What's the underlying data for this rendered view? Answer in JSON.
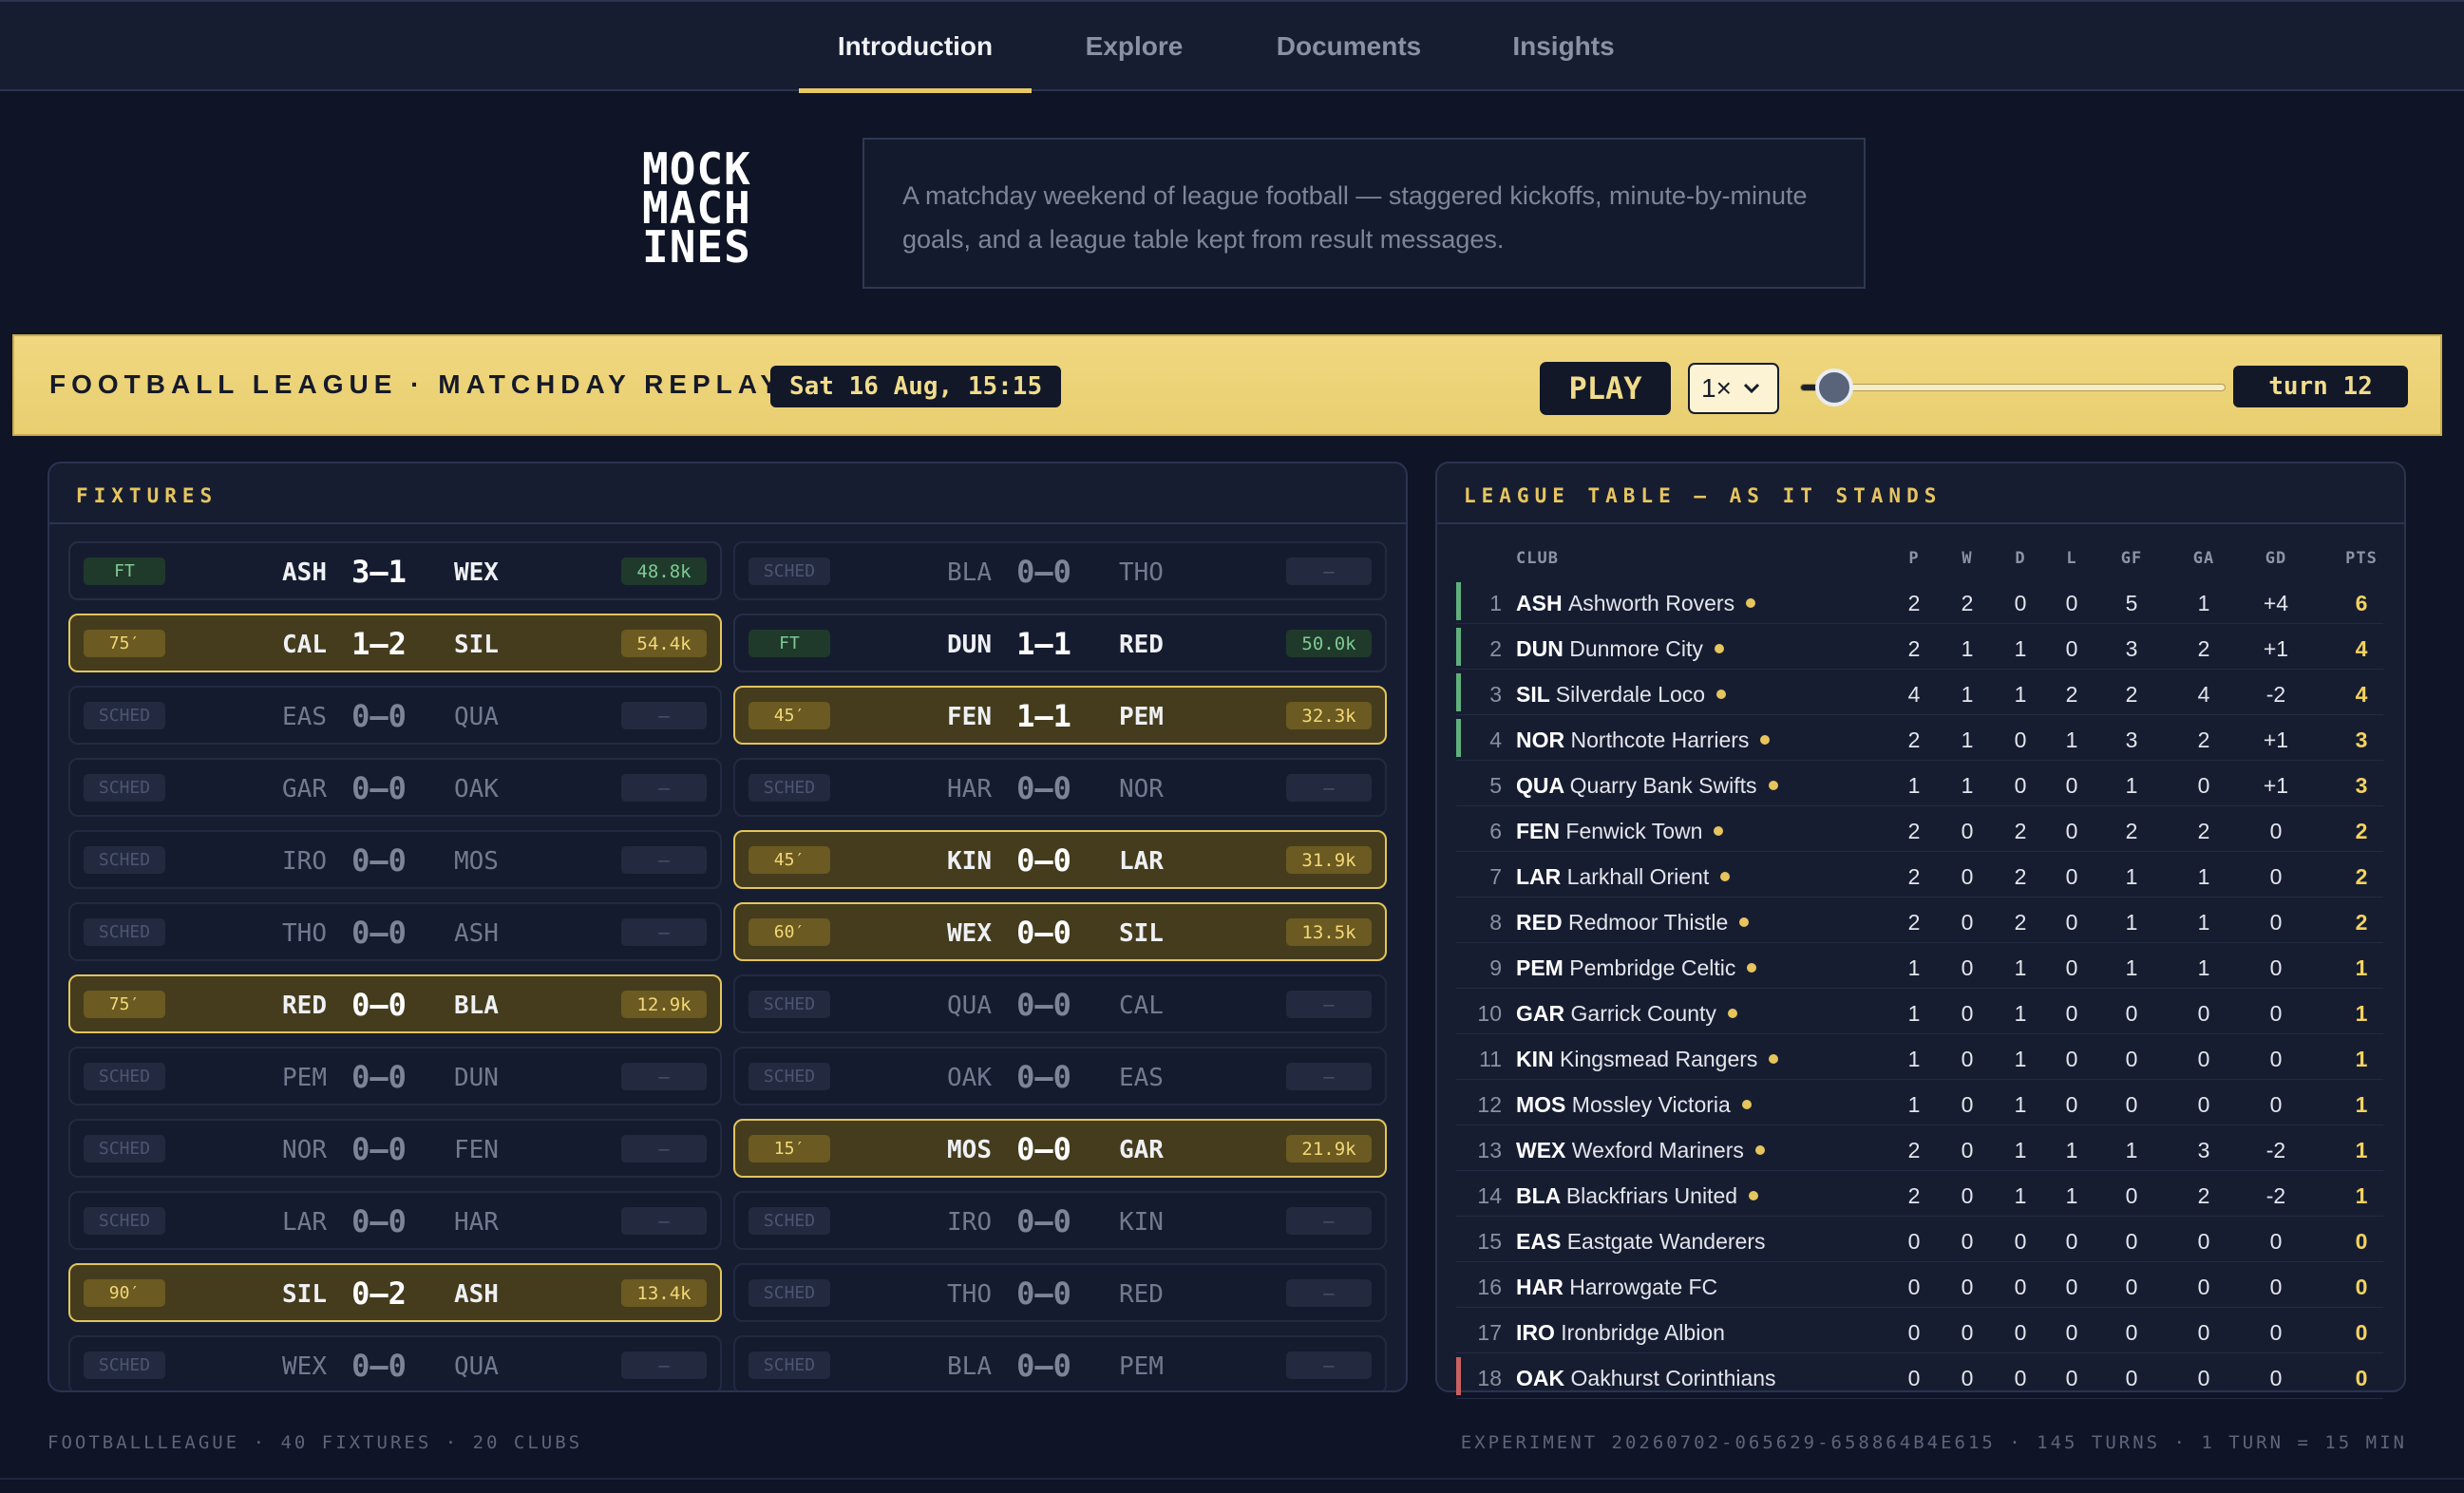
{
  "nav": {
    "tabs": [
      {
        "label": "Introduction",
        "active": true
      },
      {
        "label": "Explore",
        "active": false
      },
      {
        "label": "Documents",
        "active": false
      },
      {
        "label": "Insights",
        "active": false
      }
    ]
  },
  "logo": {
    "text": "MOCK MACH INES",
    "lines": [
      "MOCK",
      "MACH",
      "INES"
    ]
  },
  "intro": {
    "text": "A matchday weekend of league football — staggered kickoffs, minute-by-minute goals, and a league table kept from result messages."
  },
  "control_bar": {
    "title": "FOOTBALL LEAGUE · MATCHDAY REPLAY",
    "date": "Sat 16 Aug, 15:15",
    "play_label": "PLAY",
    "speed": "1×",
    "progress": 0.08,
    "turn_label": "turn 12"
  },
  "fixtures": {
    "title": "FIXTURES",
    "matches": [
      {
        "col": 0,
        "row": 0,
        "status": "ft",
        "badge": "FT",
        "home": "ASH",
        "score": "3–1",
        "away": "WEX",
        "att": "48.8k"
      },
      {
        "col": 1,
        "row": 0,
        "status": "sched",
        "badge": "SCHED",
        "home": "BLA",
        "score": "0–0",
        "away": "THO",
        "att": "–"
      },
      {
        "col": 0,
        "row": 1,
        "status": "live",
        "badge": "75′",
        "home": "CAL",
        "score": "1–2",
        "away": "SIL",
        "att": "54.4k"
      },
      {
        "col": 1,
        "row": 1,
        "status": "ft",
        "badge": "FT",
        "home": "DUN",
        "score": "1–1",
        "away": "RED",
        "att": "50.0k"
      },
      {
        "col": 0,
        "row": 2,
        "status": "sched",
        "badge": "SCHED",
        "home": "EAS",
        "score": "0–0",
        "away": "QUA",
        "att": "–"
      },
      {
        "col": 1,
        "row": 2,
        "status": "live",
        "badge": "45′",
        "home": "FEN",
        "score": "1–1",
        "away": "PEM",
        "att": "32.3k"
      },
      {
        "col": 0,
        "row": 3,
        "status": "sched",
        "badge": "SCHED",
        "home": "GAR",
        "score": "0–0",
        "away": "OAK",
        "att": "–"
      },
      {
        "col": 1,
        "row": 3,
        "status": "sched",
        "badge": "SCHED",
        "home": "HAR",
        "score": "0–0",
        "away": "NOR",
        "att": "–"
      },
      {
        "col": 0,
        "row": 4,
        "status": "sched",
        "badge": "SCHED",
        "home": "IRO",
        "score": "0–0",
        "away": "MOS",
        "att": "–"
      },
      {
        "col": 1,
        "row": 4,
        "status": "live",
        "badge": "45′",
        "home": "KIN",
        "score": "0–0",
        "away": "LAR",
        "att": "31.9k"
      },
      {
        "col": 0,
        "row": 5,
        "status": "sched",
        "badge": "SCHED",
        "home": "THO",
        "score": "0–0",
        "away": "ASH",
        "att": "–"
      },
      {
        "col": 1,
        "row": 5,
        "status": "live",
        "badge": "60′",
        "home": "WEX",
        "score": "0–0",
        "away": "SIL",
        "att": "13.5k"
      },
      {
        "col": 0,
        "row": 6,
        "status": "live",
        "badge": "75′",
        "home": "RED",
        "score": "0–0",
        "away": "BLA",
        "att": "12.9k"
      },
      {
        "col": 1,
        "row": 6,
        "status": "sched",
        "badge": "SCHED",
        "home": "QUA",
        "score": "0–0",
        "away": "CAL",
        "att": "–"
      },
      {
        "col": 0,
        "row": 7,
        "status": "sched",
        "badge": "SCHED",
        "home": "PEM",
        "score": "0–0",
        "away": "DUN",
        "att": "–"
      },
      {
        "col": 1,
        "row": 7,
        "status": "sched",
        "badge": "SCHED",
        "home": "OAK",
        "score": "0–0",
        "away": "EAS",
        "att": "–"
      },
      {
        "col": 0,
        "row": 8,
        "status": "sched",
        "badge": "SCHED",
        "home": "NOR",
        "score": "0–0",
        "away": "FEN",
        "att": "–"
      },
      {
        "col": 1,
        "row": 8,
        "status": "live",
        "badge": "15′",
        "home": "MOS",
        "score": "0–0",
        "away": "GAR",
        "att": "21.9k"
      },
      {
        "col": 0,
        "row": 9,
        "status": "sched",
        "badge": "SCHED",
        "home": "LAR",
        "score": "0–0",
        "away": "HAR",
        "att": "–"
      },
      {
        "col": 1,
        "row": 9,
        "status": "sched",
        "badge": "SCHED",
        "home": "IRO",
        "score": "0–0",
        "away": "KIN",
        "att": "–"
      },
      {
        "col": 0,
        "row": 10,
        "status": "live",
        "badge": "90′",
        "home": "SIL",
        "score": "0–2",
        "away": "ASH",
        "att": "13.4k"
      },
      {
        "col": 1,
        "row": 10,
        "status": "sched",
        "badge": "SCHED",
        "home": "THO",
        "score": "0–0",
        "away": "RED",
        "att": "–"
      },
      {
        "col": 0,
        "row": 11,
        "status": "sched",
        "badge": "SCHED",
        "home": "WEX",
        "score": "0–0",
        "away": "QUA",
        "att": "–"
      },
      {
        "col": 1,
        "row": 11,
        "status": "sched",
        "badge": "SCHED",
        "home": "BLA",
        "score": "0–0",
        "away": "PEM",
        "att": "–"
      }
    ]
  },
  "league_table": {
    "title": "LEAGUE TABLE — AS IT STANDS",
    "columns": [
      "CLUB",
      "P",
      "W",
      "D",
      "L",
      "GF",
      "GA",
      "GD",
      "PTS"
    ],
    "colors": {
      "promotion": "#5fb07c",
      "relegation": "#c96060",
      "form_dot": "#e6c55d"
    },
    "rows": [
      {
        "pos": "1",
        "abbr": "ASH",
        "name": "Ashworth Rovers",
        "form": true,
        "zone": "promotion",
        "p": "2",
        "w": "2",
        "d": "0",
        "l": "0",
        "gf": "5",
        "ga": "1",
        "gd": "+4",
        "pts": "6"
      },
      {
        "pos": "2",
        "abbr": "DUN",
        "name": "Dunmore City",
        "form": true,
        "zone": "promotion",
        "p": "2",
        "w": "1",
        "d": "1",
        "l": "0",
        "gf": "3",
        "ga": "2",
        "gd": "+1",
        "pts": "4"
      },
      {
        "pos": "3",
        "abbr": "SIL",
        "name": "Silverdale Loco",
        "form": true,
        "zone": "promotion",
        "p": "4",
        "w": "1",
        "d": "1",
        "l": "2",
        "gf": "2",
        "ga": "4",
        "gd": "-2",
        "pts": "4"
      },
      {
        "pos": "4",
        "abbr": "NOR",
        "name": "Northcote Harriers",
        "form": true,
        "zone": "promotion",
        "p": "2",
        "w": "1",
        "d": "0",
        "l": "1",
        "gf": "3",
        "ga": "2",
        "gd": "+1",
        "pts": "3"
      },
      {
        "pos": "5",
        "abbr": "QUA",
        "name": "Quarry Bank Swifts",
        "form": true,
        "zone": "",
        "p": "1",
        "w": "1",
        "d": "0",
        "l": "0",
        "gf": "1",
        "ga": "0",
        "gd": "+1",
        "pts": "3"
      },
      {
        "pos": "6",
        "abbr": "FEN",
        "name": "Fenwick Town",
        "form": true,
        "zone": "",
        "p": "2",
        "w": "0",
        "d": "2",
        "l": "0",
        "gf": "2",
        "ga": "2",
        "gd": "0",
        "pts": "2"
      },
      {
        "pos": "7",
        "abbr": "LAR",
        "name": "Larkhall Orient",
        "form": true,
        "zone": "",
        "p": "2",
        "w": "0",
        "d": "2",
        "l": "0",
        "gf": "1",
        "ga": "1",
        "gd": "0",
        "pts": "2"
      },
      {
        "pos": "8",
        "abbr": "RED",
        "name": "Redmoor Thistle",
        "form": true,
        "zone": "",
        "p": "2",
        "w": "0",
        "d": "2",
        "l": "0",
        "gf": "1",
        "ga": "1",
        "gd": "0",
        "pts": "2"
      },
      {
        "pos": "9",
        "abbr": "PEM",
        "name": "Pembridge Celtic",
        "form": true,
        "zone": "",
        "p": "1",
        "w": "0",
        "d": "1",
        "l": "0",
        "gf": "1",
        "ga": "1",
        "gd": "0",
        "pts": "1"
      },
      {
        "pos": "10",
        "abbr": "GAR",
        "name": "Garrick County",
        "form": true,
        "zone": "",
        "p": "1",
        "w": "0",
        "d": "1",
        "l": "0",
        "gf": "0",
        "ga": "0",
        "gd": "0",
        "pts": "1"
      },
      {
        "pos": "11",
        "abbr": "KIN",
        "name": "Kingsmead Rangers",
        "form": true,
        "zone": "",
        "p": "1",
        "w": "0",
        "d": "1",
        "l": "0",
        "gf": "0",
        "ga": "0",
        "gd": "0",
        "pts": "1"
      },
      {
        "pos": "12",
        "abbr": "MOS",
        "name": "Mossley Victoria",
        "form": true,
        "zone": "",
        "p": "1",
        "w": "0",
        "d": "1",
        "l": "0",
        "gf": "0",
        "ga": "0",
        "gd": "0",
        "pts": "1"
      },
      {
        "pos": "13",
        "abbr": "WEX",
        "name": "Wexford Mariners",
        "form": true,
        "zone": "",
        "p": "2",
        "w": "0",
        "d": "1",
        "l": "1",
        "gf": "1",
        "ga": "3",
        "gd": "-2",
        "pts": "1"
      },
      {
        "pos": "14",
        "abbr": "BLA",
        "name": "Blackfriars United",
        "form": true,
        "zone": "",
        "p": "2",
        "w": "0",
        "d": "1",
        "l": "1",
        "gf": "0",
        "ga": "2",
        "gd": "-2",
        "pts": "1"
      },
      {
        "pos": "15",
        "abbr": "EAS",
        "name": "Eastgate Wanderers",
        "form": false,
        "zone": "",
        "p": "0",
        "w": "0",
        "d": "0",
        "l": "0",
        "gf": "0",
        "ga": "0",
        "gd": "0",
        "pts": "0"
      },
      {
        "pos": "16",
        "abbr": "HAR",
        "name": "Harrowgate FC",
        "form": false,
        "zone": "",
        "p": "0",
        "w": "0",
        "d": "0",
        "l": "0",
        "gf": "0",
        "ga": "0",
        "gd": "0",
        "pts": "0"
      },
      {
        "pos": "17",
        "abbr": "IRO",
        "name": "Ironbridge Albion",
        "form": false,
        "zone": "",
        "p": "0",
        "w": "0",
        "d": "0",
        "l": "0",
        "gf": "0",
        "ga": "0",
        "gd": "0",
        "pts": "0"
      },
      {
        "pos": "18",
        "abbr": "OAK",
        "name": "Oakhurst Corinthians",
        "form": false,
        "zone": "relegation",
        "p": "0",
        "w": "0",
        "d": "0",
        "l": "0",
        "gf": "0",
        "ga": "0",
        "gd": "0",
        "pts": "0"
      }
    ]
  },
  "footer": {
    "left": "FOOTBALLLEAGUE · 40 FIXTURES · 20 CLUBS",
    "right": "EXPERIMENT 20260702-065629-658864B4E615 · 145 TURNS · 1 TURN = 15 MIN"
  }
}
